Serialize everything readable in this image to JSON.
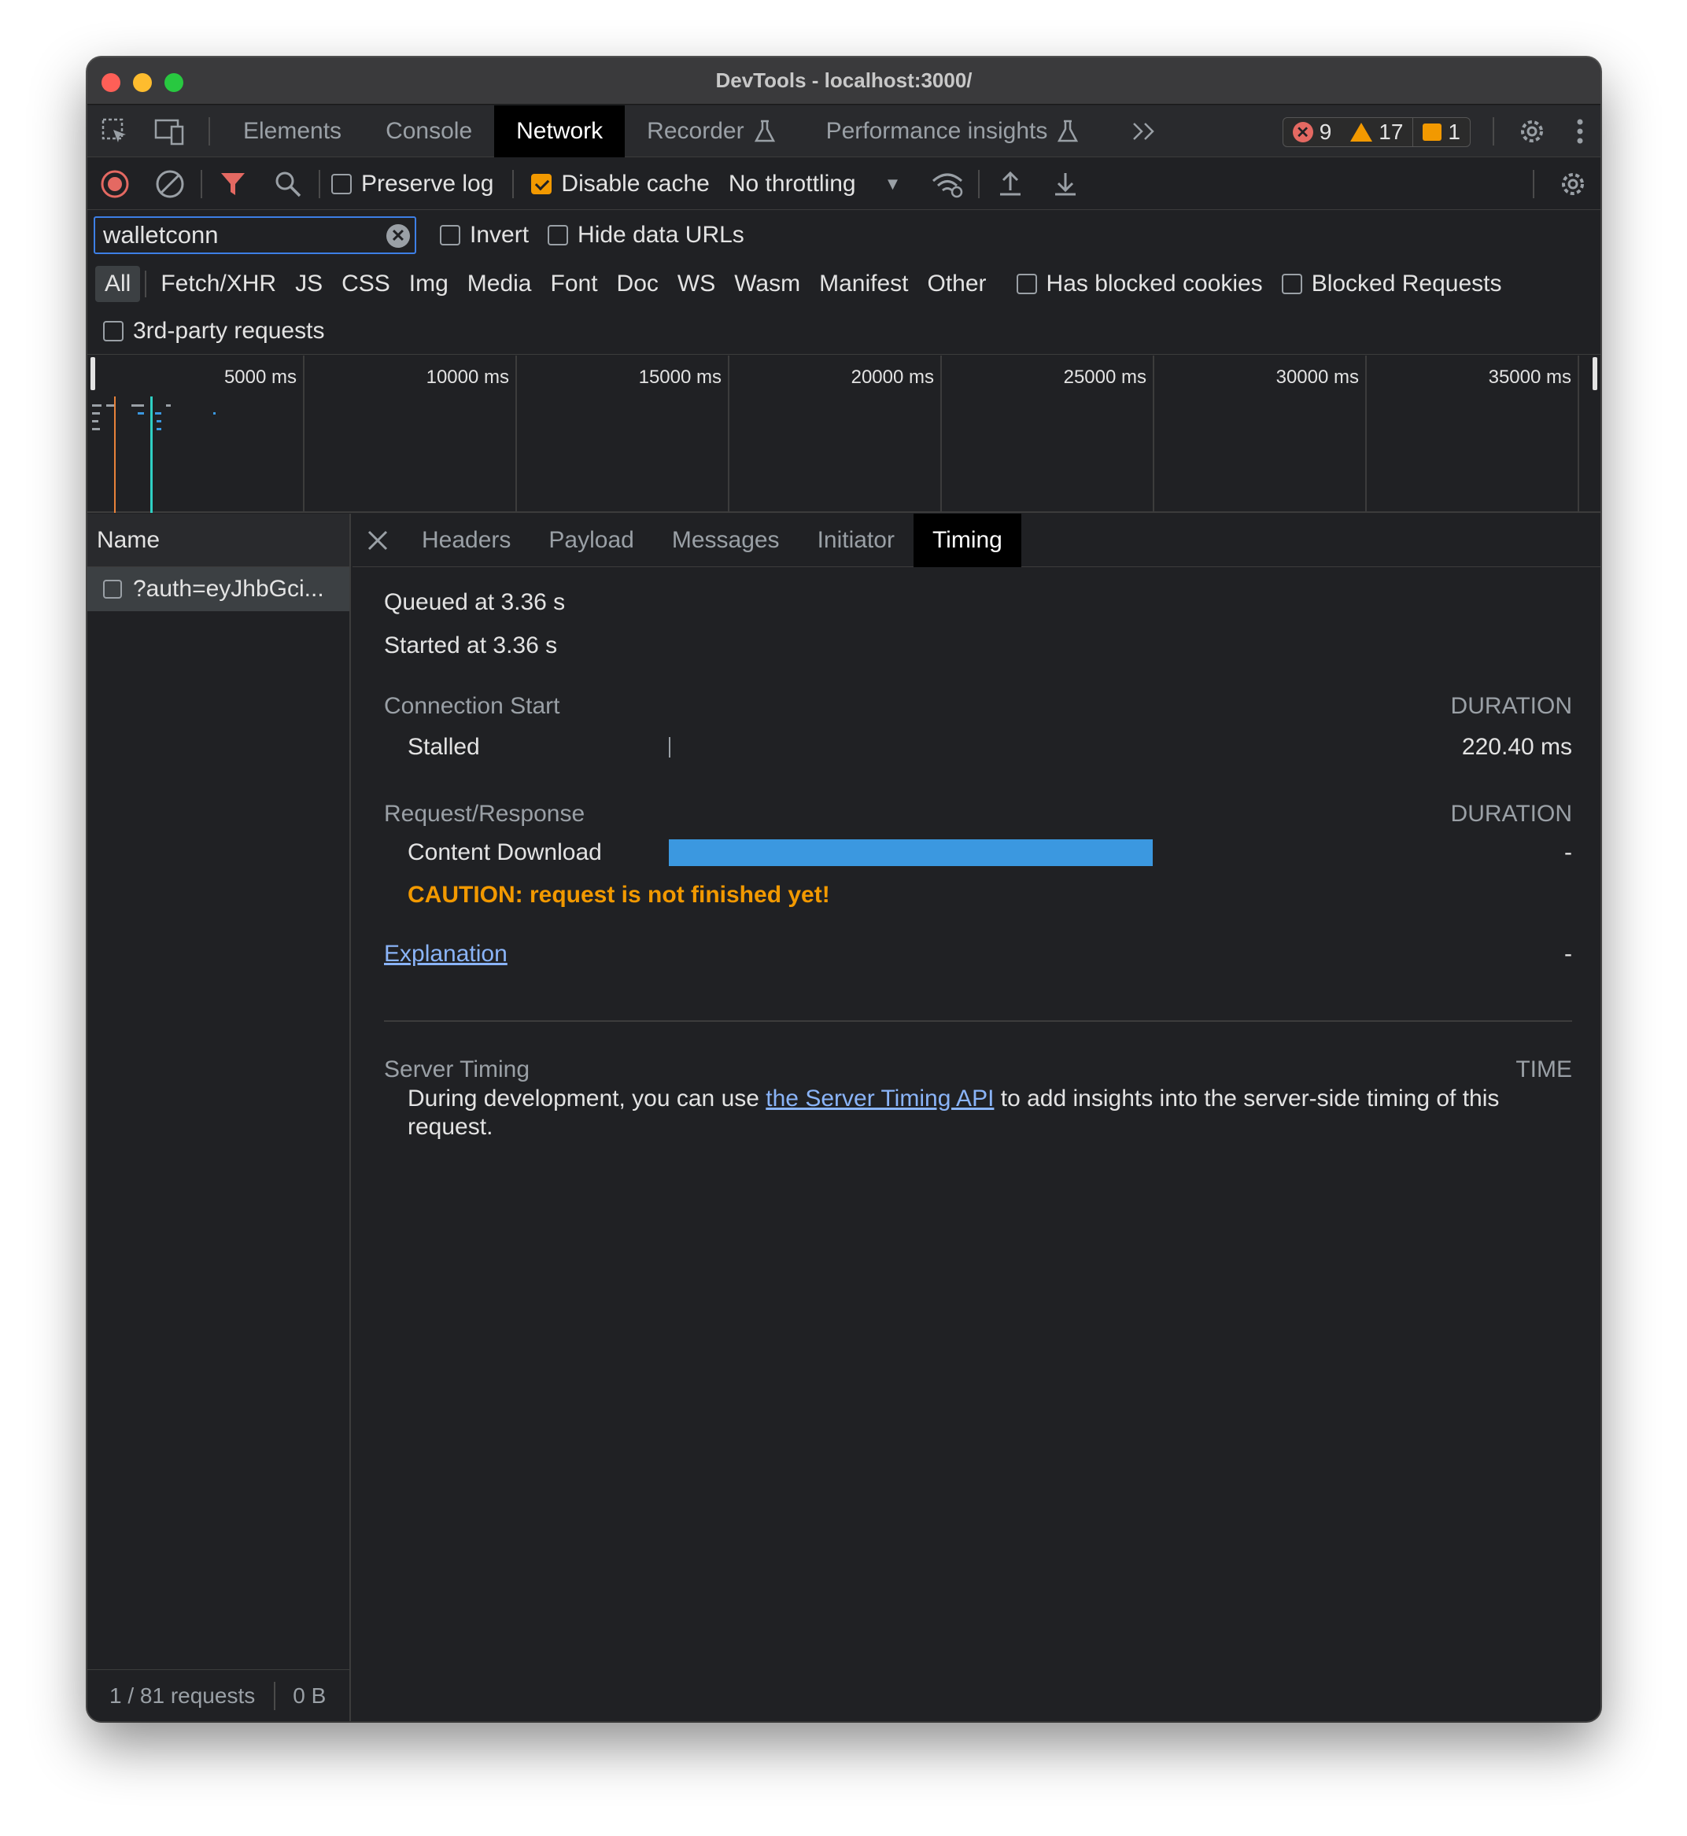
{
  "window": {
    "title": "DevTools - localhost:3000/"
  },
  "panel_tabs": [
    "Elements",
    "Console",
    "Network",
    "Recorder",
    "Performance insights"
  ],
  "active_panel_tab": "Network",
  "badges": {
    "errors": "9",
    "warnings": "17",
    "info": "1"
  },
  "toolbar": {
    "preserve_log": "Preserve log",
    "disable_cache": "Disable cache",
    "throttling": "No throttling"
  },
  "filter": {
    "value": "walletconn",
    "invert": "Invert",
    "hide_data_urls": "Hide data URLs"
  },
  "type_filters": [
    "All",
    "Fetch/XHR",
    "JS",
    "CSS",
    "Img",
    "Media",
    "Font",
    "Doc",
    "WS",
    "Wasm",
    "Manifest",
    "Other"
  ],
  "extra_filters": {
    "blocked_cookies": "Has blocked cookies",
    "blocked_requests": "Blocked Requests",
    "third_party": "3rd-party requests"
  },
  "overview": {
    "ticks": [
      "5000 ms",
      "10000 ms",
      "15000 ms",
      "20000 ms",
      "25000 ms",
      "30000 ms",
      "35000 ms"
    ]
  },
  "requests": {
    "header": "Name",
    "rows": [
      "?auth=eyJhbGci..."
    ],
    "status_count": "1 / 81 requests",
    "status_size": "0 B"
  },
  "detail_tabs": [
    "Headers",
    "Payload",
    "Messages",
    "Initiator",
    "Timing"
  ],
  "active_detail_tab": "Timing",
  "timing": {
    "queued": "Queued at 3.36 s",
    "started": "Started at 3.36 s",
    "connection_start": "Connection Start",
    "duration_label": "DURATION",
    "stalled": "Stalled",
    "stalled_value": "220.40 ms",
    "request_response": "Request/Response",
    "content_download": "Content Download",
    "content_download_value": "-",
    "content_download_bar": {
      "start_fraction": 0.0,
      "width_fraction": 0.615
    },
    "caution": "CAUTION: request is not finished yet!",
    "explanation": "Explanation",
    "explanation_value": "-",
    "server_timing": "Server Timing",
    "time_label": "TIME",
    "server_text_before": "During development, you can use ",
    "server_link": "the Server Timing API",
    "server_text_after": " to add insights into the server-side timing of this request."
  }
}
